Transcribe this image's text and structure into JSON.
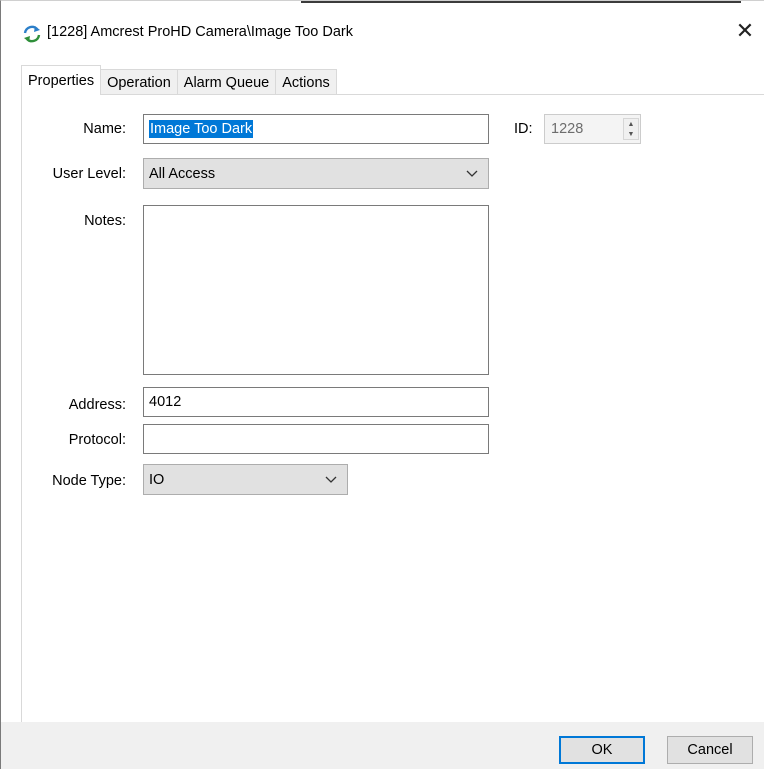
{
  "window": {
    "title": "[1228] Amcrest ProHD Camera\\Image Too Dark",
    "close_glyph": "✕"
  },
  "tabs": [
    {
      "label": "Properties",
      "active": true
    },
    {
      "label": "Operation",
      "active": false
    },
    {
      "label": "Alarm Queue",
      "active": false
    },
    {
      "label": "Actions",
      "active": false
    }
  ],
  "form": {
    "name_label": "Name:",
    "name_value": "Image Too Dark",
    "id_label": "ID:",
    "id_value": "1228",
    "user_level_label": "User Level:",
    "user_level_value": "All Access",
    "notes_label": "Notes:",
    "notes_value": "",
    "address_label": "Address:",
    "address_value": "4012",
    "protocol_label": "Protocol:",
    "protocol_value": "",
    "node_type_label": "Node Type:",
    "node_type_value": "IO"
  },
  "buttons": {
    "ok_label": "OK",
    "cancel_label": "Cancel"
  },
  "colors": {
    "selection": "#0078d7",
    "default_button_border": "#0078d7"
  },
  "icons": {
    "app": "refresh-arrows-icon",
    "close": "close-icon",
    "dropdown": "chevron-down-icon",
    "spinner": "spinner-arrows-icon"
  }
}
